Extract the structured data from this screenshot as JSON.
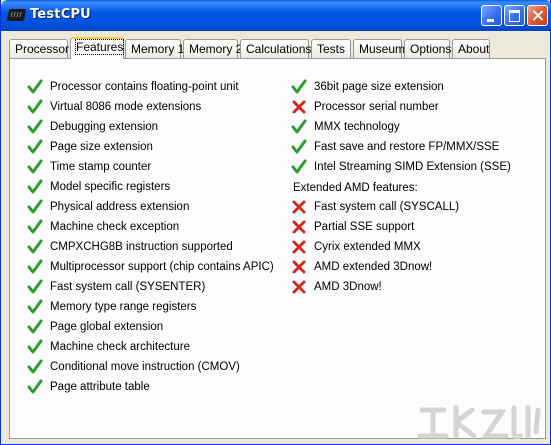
{
  "window": {
    "title": "TestCPU"
  },
  "tabs": [
    {
      "label": "Processor",
      "active": false
    },
    {
      "label": "Features",
      "active": true
    },
    {
      "label": "Memory 1",
      "active": false
    },
    {
      "label": "Memory 2",
      "active": false
    },
    {
      "label": "Calculations",
      "active": false
    },
    {
      "label": "Tests",
      "active": false
    },
    {
      "label": "Museum",
      "active": false
    },
    {
      "label": "Options",
      "active": false
    },
    {
      "label": "About",
      "active": false
    }
  ],
  "features_left": [
    {
      "label": "Processor contains floating-point unit",
      "status": "yes"
    },
    {
      "label": "Virtual 8086 mode extensions",
      "status": "yes"
    },
    {
      "label": "Debugging extension",
      "status": "yes"
    },
    {
      "label": "Page size extension",
      "status": "yes"
    },
    {
      "label": "Time stamp counter",
      "status": "yes"
    },
    {
      "label": "Model specific registers",
      "status": "yes"
    },
    {
      "label": "Physical address extension",
      "status": "yes"
    },
    {
      "label": "Machine check exception",
      "status": "yes"
    },
    {
      "label": "CMPXCHG8B instruction supported",
      "status": "yes"
    },
    {
      "label": "Multiprocessor support (chip contains APIC)",
      "status": "yes"
    },
    {
      "label": "Fast system call (SYSENTER)",
      "status": "yes"
    },
    {
      "label": "Memory type range registers",
      "status": "yes"
    },
    {
      "label": "Page global extension",
      "status": "yes"
    },
    {
      "label": "Machine check architecture",
      "status": "yes"
    },
    {
      "label": "Conditional move instruction (CMOV)",
      "status": "yes"
    },
    {
      "label": "Page attribute table",
      "status": "yes"
    }
  ],
  "features_right": [
    {
      "label": "36bit page size extension",
      "status": "yes"
    },
    {
      "label": "Processor serial number",
      "status": "no"
    },
    {
      "label": "MMX technology",
      "status": "yes"
    },
    {
      "label": "Fast save and restore FP/MMX/SSE",
      "status": "yes"
    },
    {
      "label": "Intel Streaming SIMD Extension (SSE)",
      "status": "yes"
    }
  ],
  "amd_section": {
    "header": "Extended AMD features:",
    "items": [
      {
        "label": "Fast system call (SYSCALL)",
        "status": "no"
      },
      {
        "label": "Partial SSE support",
        "status": "no"
      },
      {
        "label": "Cyrix extended MMX",
        "status": "no"
      },
      {
        "label": "AMD extended 3Dnow!",
        "status": "no"
      },
      {
        "label": "AMD 3Dnow!",
        "status": "no"
      }
    ]
  },
  "colors": {
    "check": "#2E9C2E",
    "cross": "#D42A1E",
    "titlebar": "#0055E5",
    "active_tab_accent": "#FFC83C"
  },
  "icons": {
    "yes": "check-icon",
    "no": "cross-icon"
  }
}
